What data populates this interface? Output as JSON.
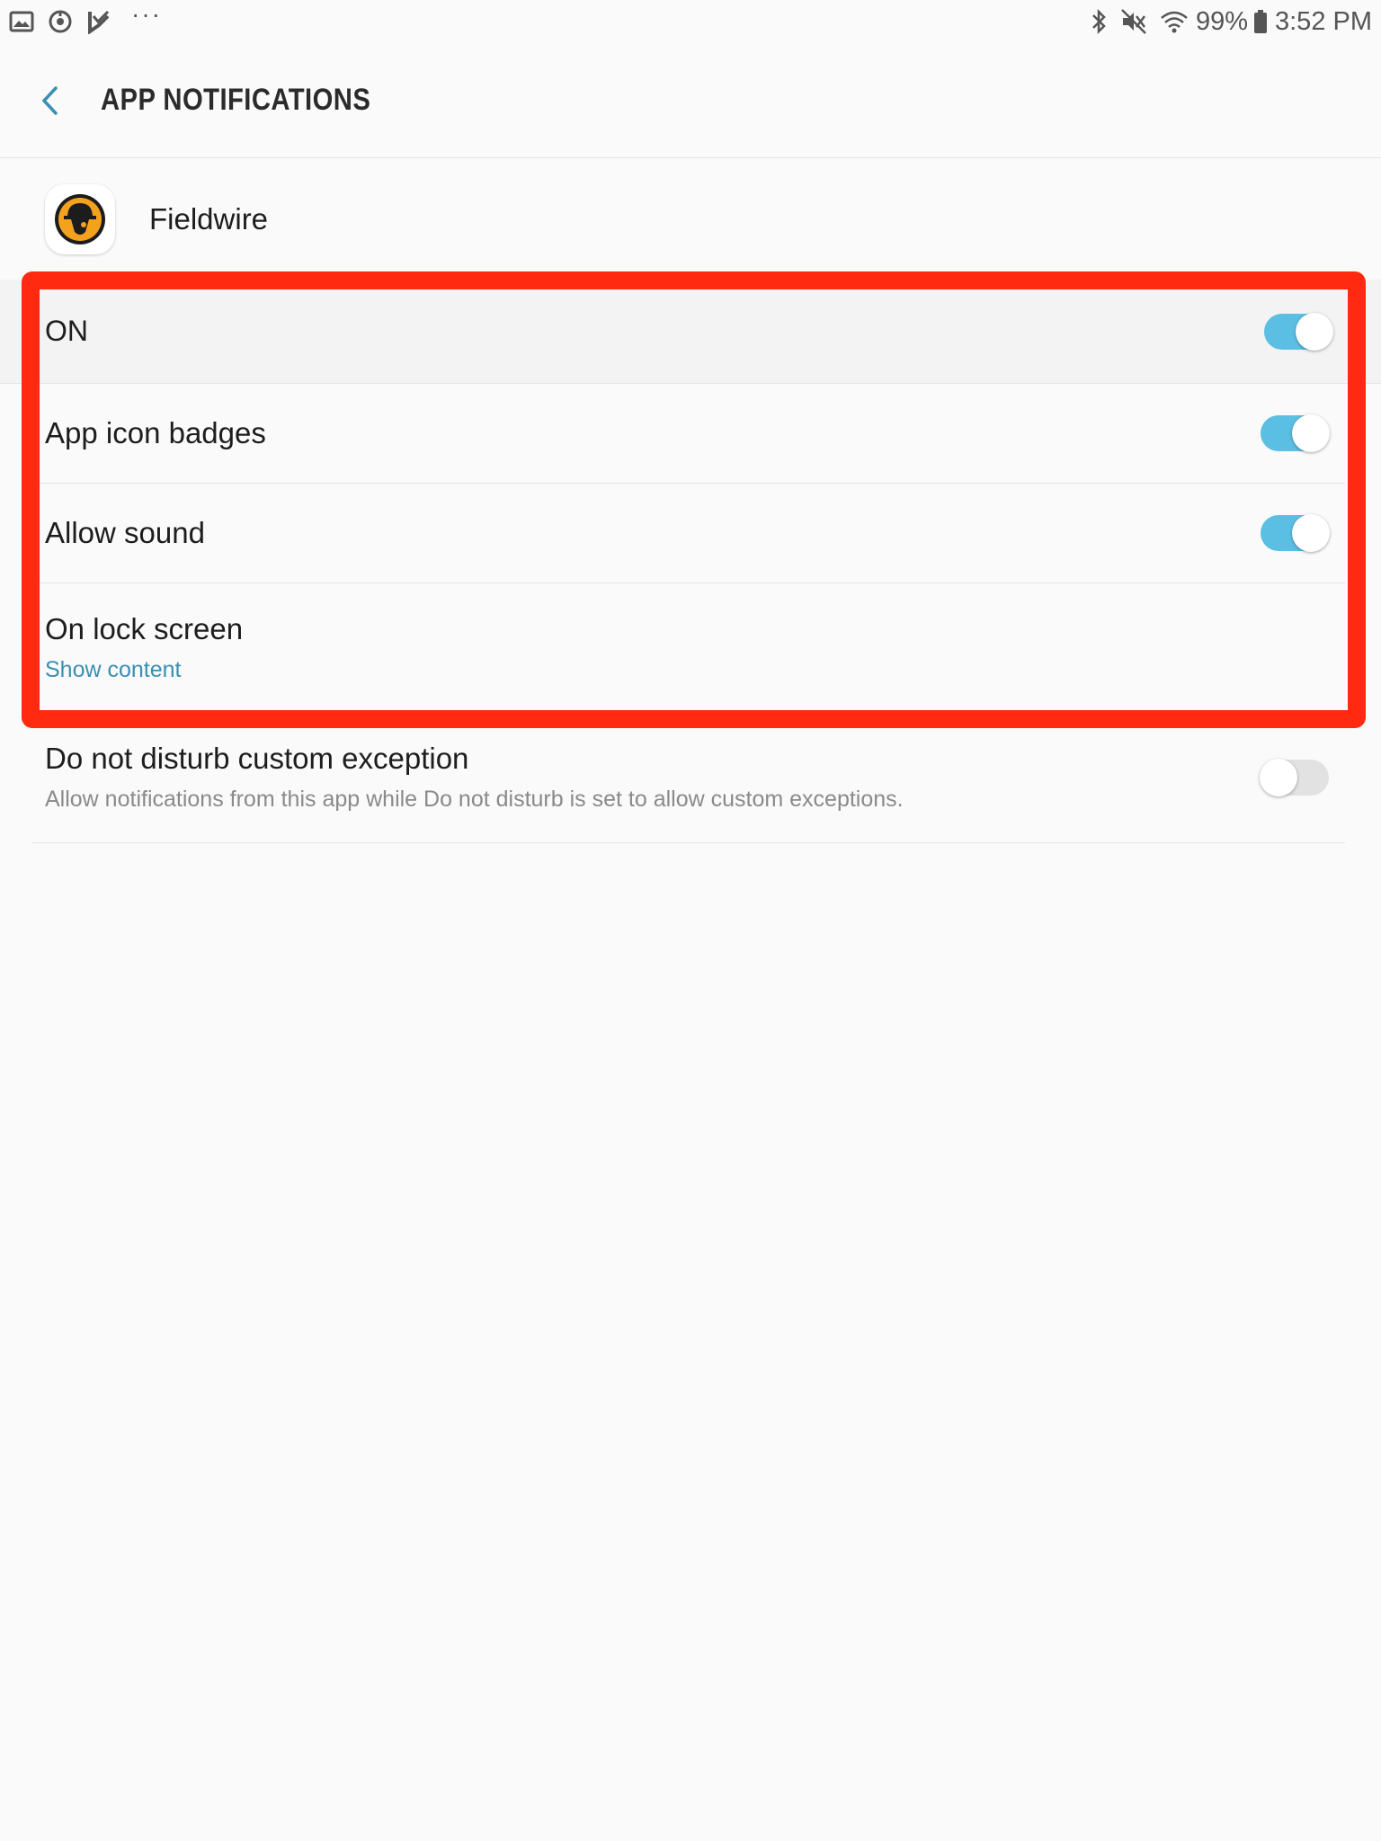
{
  "status_bar": {
    "left_icons": [
      "gallery-icon",
      "sync-icon",
      "task-icon"
    ],
    "more": "···",
    "right_icons": [
      "bluetooth-icon",
      "mute-icon",
      "wifi-icon"
    ],
    "battery": "99%",
    "time": "3:52 PM"
  },
  "header": {
    "back_icon": "back-chevron-icon",
    "title": "APP NOTIFICATIONS"
  },
  "app": {
    "name": "Fieldwire",
    "icon": "fieldwire-app-icon"
  },
  "settings": {
    "on": {
      "label": "ON",
      "enabled": true
    },
    "badges": {
      "label": "App icon badges",
      "enabled": true
    },
    "sound": {
      "label": "Allow sound",
      "enabled": true
    },
    "lock_screen": {
      "label": "On lock screen",
      "value": "Show content"
    },
    "dnd": {
      "label": "Do not disturb custom exception",
      "description": "Allow notifications from this app while Do not disturb is set to allow custom exceptions.",
      "enabled": false
    }
  },
  "colors": {
    "accent": "#3a8fb0",
    "toggle_on": "#5bbfe3",
    "highlight": "#ff2a10"
  }
}
